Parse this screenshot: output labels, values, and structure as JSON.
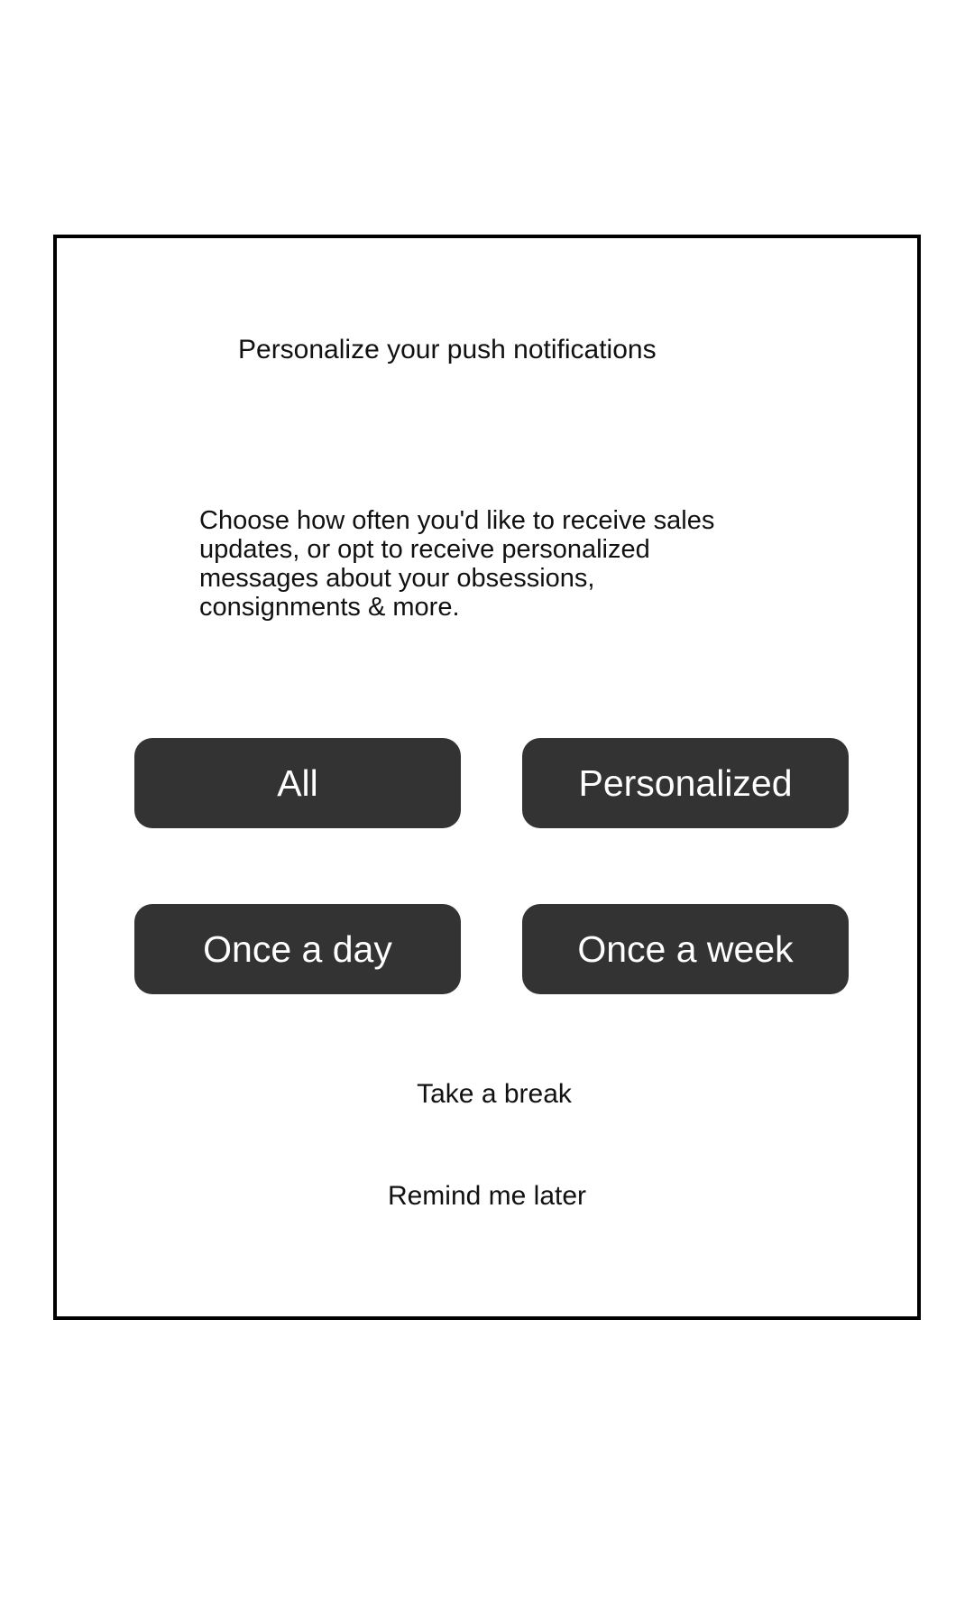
{
  "dialog": {
    "title": "Personalize your push notifications",
    "description": "Choose how often you'd like to receive sales updates, or opt to receive personalized messages about your obsessions, consignments & more.",
    "options": {
      "all": "All",
      "personalized": "Personalized",
      "once_a_day": "Once a day",
      "once_a_week": "Once a week"
    },
    "actions": {
      "take_a_break": "Take a break",
      "remind_me_later": "Remind me later"
    },
    "colors": {
      "button_background": "#333333",
      "button_text": "#ffffff",
      "border": "#000000",
      "text": "#111111"
    }
  }
}
